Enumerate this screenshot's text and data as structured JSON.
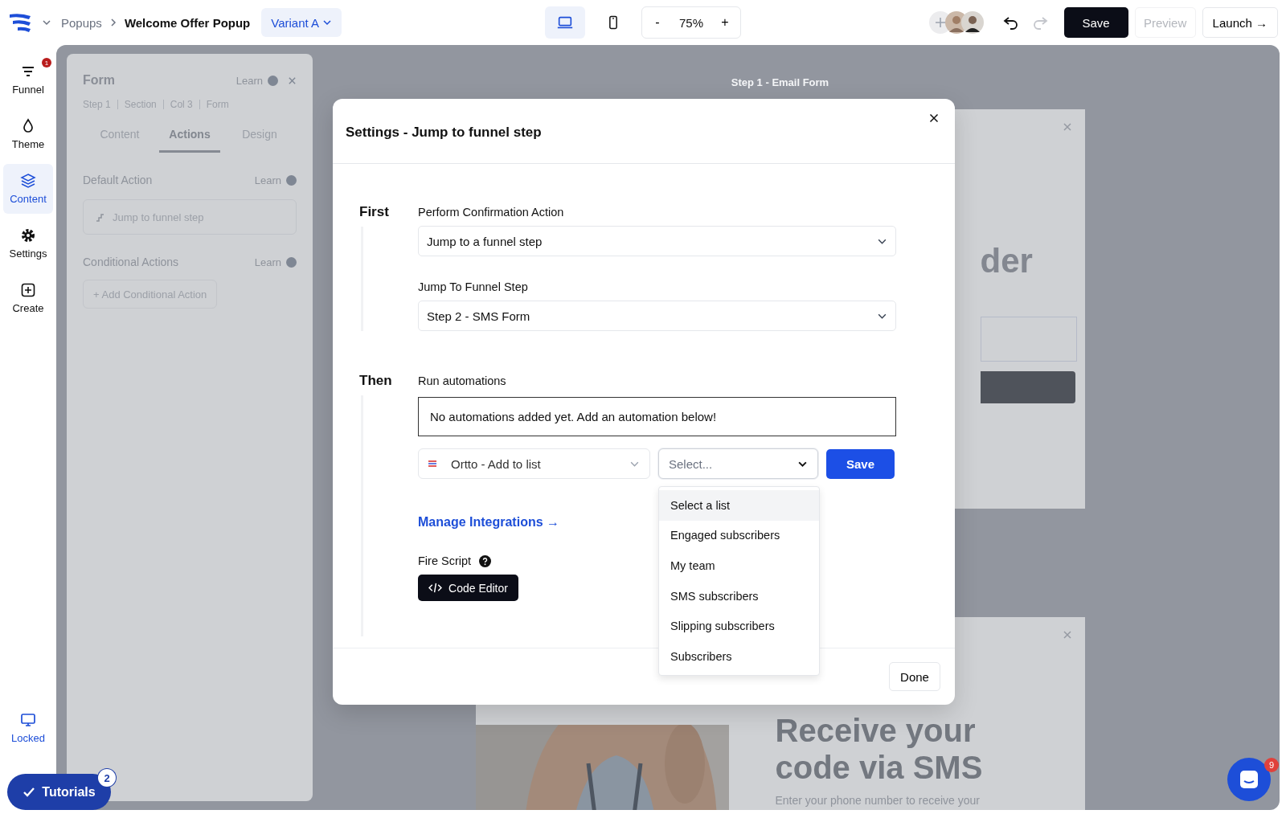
{
  "topbar": {
    "breadcrumb": [
      {
        "label": "Popups",
        "current": false
      },
      {
        "label": "Welcome Offer Popup",
        "current": true
      }
    ],
    "variant": "Variant A",
    "devices": [
      {
        "kind": "desktop",
        "selected": true
      },
      {
        "kind": "mobile",
        "selected": false
      }
    ],
    "zoom": {
      "decrease": "-",
      "value": "75%",
      "increase": "+"
    },
    "save": "Save",
    "preview": {
      "label": "Preview",
      "disabled": true
    },
    "launch": "Launch →"
  },
  "rail": {
    "items": [
      {
        "kind": "funnel",
        "label": "Funnel",
        "selected": false,
        "badge": "1"
      },
      {
        "kind": "theme",
        "label": "Theme",
        "selected": false
      },
      {
        "kind": "content",
        "label": "Content",
        "selected": true
      },
      {
        "kind": "settings",
        "label": "Settings",
        "selected": false
      },
      {
        "kind": "create",
        "label": "Create",
        "selected": false
      }
    ],
    "lock": {
      "label": "Locked"
    },
    "tutorials": {
      "label": "Tutorials",
      "badge": "2"
    }
  },
  "panel": {
    "title": "Form",
    "learn": "Learn",
    "path": [
      "Step 1",
      "Section",
      "Col 3",
      "Form"
    ],
    "tabs": [
      {
        "label": "Content",
        "selected": false
      },
      {
        "label": "Actions",
        "selected": true
      },
      {
        "label": "Design",
        "selected": false
      }
    ],
    "sections": [
      {
        "title": "Default Action",
        "learn": "Learn",
        "kind": "action",
        "value": "Jump to funnel step"
      },
      {
        "title": "Conditional Actions",
        "learn": "Learn",
        "kind": "add",
        "value": "+ Add Conditional Action"
      }
    ]
  },
  "canvas": {
    "step_label": "Step 1 - Email Form",
    "cards": [
      {
        "kind": "email",
        "heading": "der"
      },
      {
        "kind": "sms",
        "heading": "Receive your code via SMS",
        "body": "Enter your phone number to receive your"
      }
    ]
  },
  "modal": {
    "title": "Settings - Jump to funnel step",
    "first": {
      "label": "First",
      "fields": [
        {
          "label": "Perform Confirmation Action",
          "value": "Jump to a funnel step"
        },
        {
          "label": "Jump To Funnel Step",
          "value": "Step 2 - SMS Form"
        }
      ]
    },
    "then": {
      "label": "Then",
      "automations_label": "Run automations",
      "automations_empty": "No automations added yet. Add an automation below!",
      "integration": "Ortto - Add to list",
      "list_select": {
        "placeholder": "Select...",
        "expanded": true,
        "options": [
          {
            "label": "Select a list",
            "selected": true
          },
          {
            "label": "Engaged subscribers",
            "selected": false
          },
          {
            "label": "My team",
            "selected": false
          },
          {
            "label": "SMS subscribers",
            "selected": false
          },
          {
            "label": "Slipping subscribers",
            "selected": false
          },
          {
            "label": "Subscribers",
            "selected": false
          }
        ]
      },
      "save": "Save",
      "manage_link": "Manage Integrations →",
      "fire_script": "Fire Script",
      "code_editor": "Code Editor"
    },
    "done": "Done"
  },
  "chat": {
    "badge": "9"
  }
}
